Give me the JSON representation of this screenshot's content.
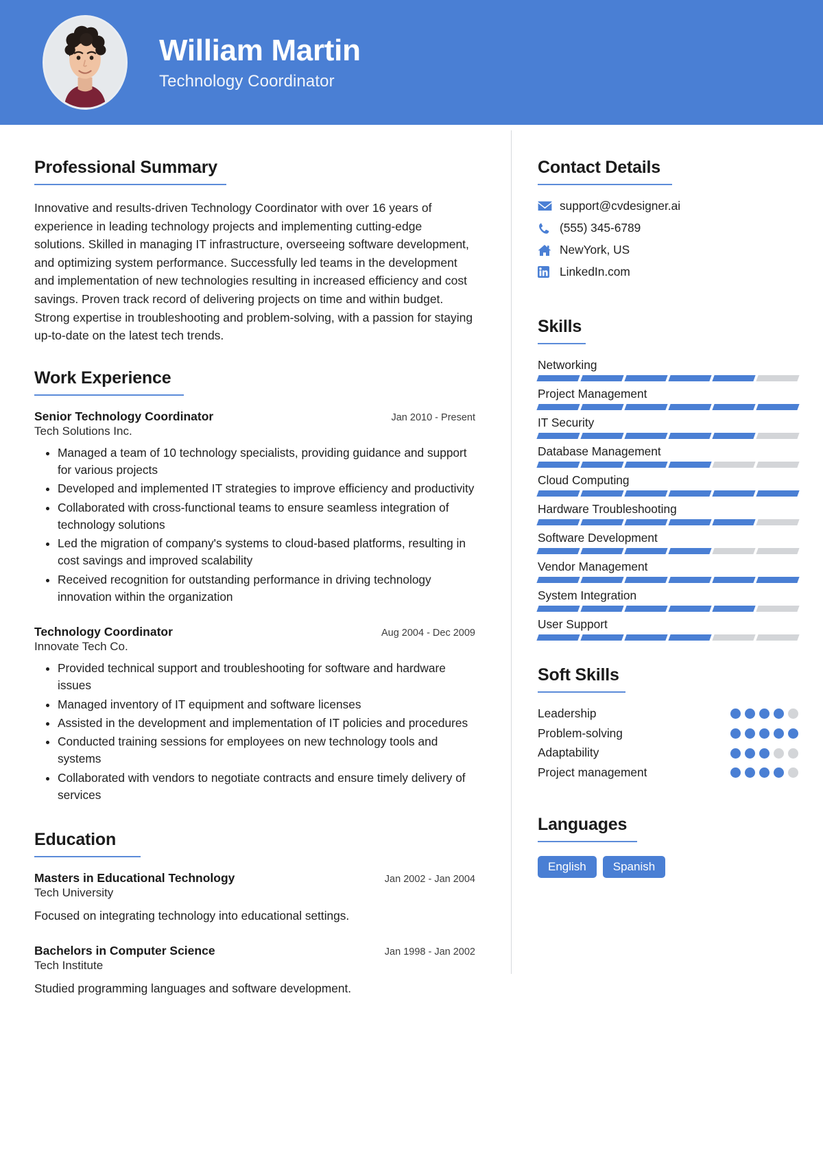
{
  "theme": {
    "accent": "#4a7fd4",
    "track": "#d3d5d8",
    "text": "#1f1f1f"
  },
  "header": {
    "name": "William Martin",
    "role": "Technology Coordinator",
    "avatar_icon": "profile-photo"
  },
  "left": {
    "summary": {
      "heading": "Professional Summary",
      "text": "Innovative and results-driven Technology Coordinator with over 16 years of experience in leading technology projects and implementing cutting-edge solutions. Skilled in managing IT infrastructure, overseeing software development, and optimizing system performance. Successfully led teams in the development and implementation of new technologies resulting in increased efficiency and cost savings. Proven track record of delivering projects on time and within budget. Strong expertise in troubleshooting and problem-solving, with a passion for staying up-to-date on the latest tech trends."
    },
    "work": {
      "heading": "Work Experience",
      "jobs": [
        {
          "title": "Senior Technology Coordinator",
          "date": "Jan 2010 - Present",
          "org": "Tech Solutions Inc.",
          "bullets": [
            "Managed a team of 10 technology specialists, providing guidance and support for various projects",
            "Developed and implemented IT strategies to improve efficiency and productivity",
            "Collaborated with cross-functional teams to ensure seamless integration of technology solutions",
            "Led the migration of company's systems to cloud-based platforms, resulting in cost savings and improved scalability",
            "Received recognition for outstanding performance in driving technology innovation within the organization"
          ]
        },
        {
          "title": "Technology Coordinator",
          "date": "Aug 2004 - Dec 2009",
          "org": "Innovate Tech Co.",
          "bullets": [
            "Provided technical support and troubleshooting for software and hardware issues",
            "Managed inventory of IT equipment and software licenses",
            "Assisted in the development and implementation of IT policies and procedures",
            "Conducted training sessions for employees on new technology tools and systems",
            "Collaborated with vendors to negotiate contracts and ensure timely delivery of services"
          ]
        }
      ]
    },
    "education": {
      "heading": "Education",
      "entries": [
        {
          "degree": "Masters in Educational Technology",
          "date": "Jan 2002 - Jan 2004",
          "school": "Tech University",
          "description": "Focused on integrating technology into educational settings."
        },
        {
          "degree": "Bachelors in Computer Science",
          "date": "Jan 1998 - Jan 2002",
          "school": "Tech Institute",
          "description": "Studied programming languages and software development."
        }
      ]
    }
  },
  "right": {
    "contact": {
      "heading": "Contact Details",
      "items": [
        {
          "icon": "envelope-icon",
          "value": "support@cvdesigner.ai"
        },
        {
          "icon": "phone-icon",
          "value": "(555) 345-6789"
        },
        {
          "icon": "home-icon",
          "value": "NewYork, US"
        },
        {
          "icon": "linkedin-icon",
          "value": "LinkedIn.com"
        }
      ]
    },
    "skills": {
      "heading": "Skills",
      "segments_total": 6,
      "items": [
        {
          "name": "Networking",
          "level": 5
        },
        {
          "name": "Project Management",
          "level": 6
        },
        {
          "name": "IT Security",
          "level": 5
        },
        {
          "name": "Database Management",
          "level": 4
        },
        {
          "name": "Cloud Computing",
          "level": 6
        },
        {
          "name": "Hardware Troubleshooting",
          "level": 5
        },
        {
          "name": "Software Development",
          "level": 4
        },
        {
          "name": "Vendor Management",
          "level": 6
        },
        {
          "name": "System Integration",
          "level": 5
        },
        {
          "name": "User Support",
          "level": 4
        }
      ]
    },
    "soft_skills": {
      "heading": "Soft Skills",
      "dots_total": 5,
      "items": [
        {
          "name": "Leadership",
          "level": 4
        },
        {
          "name": "Problem-solving",
          "level": 5
        },
        {
          "name": "Adaptability",
          "level": 3
        },
        {
          "name": "Project management",
          "level": 4
        }
      ]
    },
    "languages": {
      "heading": "Languages",
      "items": [
        "English",
        "Spanish"
      ]
    }
  }
}
